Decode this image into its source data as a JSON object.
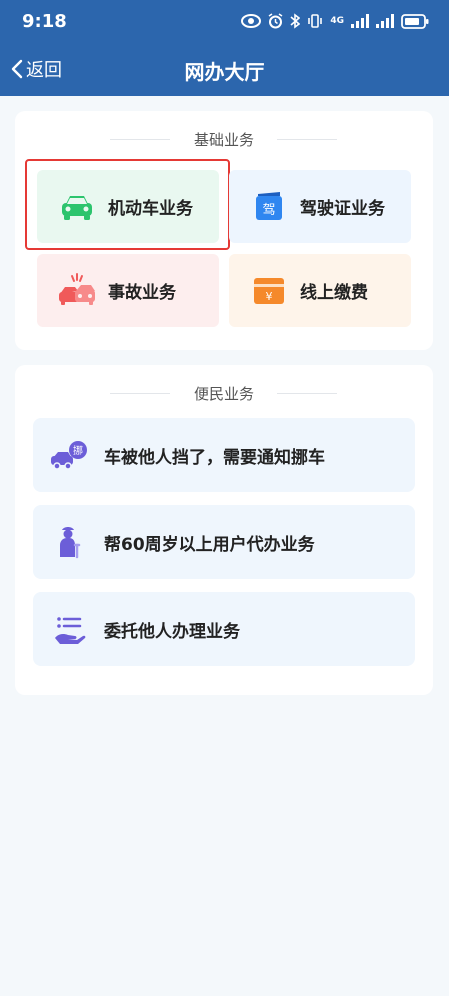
{
  "status": {
    "time": "9:18",
    "network": "4G"
  },
  "nav": {
    "back_label": "返回",
    "title": "网办大厅"
  },
  "basic": {
    "title": "基础业务",
    "tiles": [
      {
        "label": "机动车业务",
        "icon": "car-icon",
        "bg": "#e9f8f0"
      },
      {
        "label": "驾驶证业务",
        "icon": "license-icon",
        "icon_text": "驾",
        "bg": "#edf5fe"
      },
      {
        "label": "事故业务",
        "icon": "accident-icon",
        "bg": "#fdeeee"
      },
      {
        "label": "线上缴费",
        "icon": "payment-icon",
        "icon_text": "¥",
        "bg": "#fef4ea"
      }
    ]
  },
  "convenience": {
    "title": "便民业务",
    "items": [
      {
        "label": "车被他人挡了，需要通知挪车",
        "icon": "move-car-icon",
        "icon_text": "挪"
      },
      {
        "label": "帮60周岁以上用户代办业务",
        "icon": "elderly-icon"
      },
      {
        "label": "委托他人办理业务",
        "icon": "delegate-icon"
      }
    ]
  },
  "colors": {
    "header": "#2c66ad",
    "highlight": "#e53935",
    "green": "#2cc46d",
    "blue": "#2f86f0",
    "red": "#f05a5a",
    "orange": "#f5892b",
    "purple": "#6c5ed8"
  }
}
